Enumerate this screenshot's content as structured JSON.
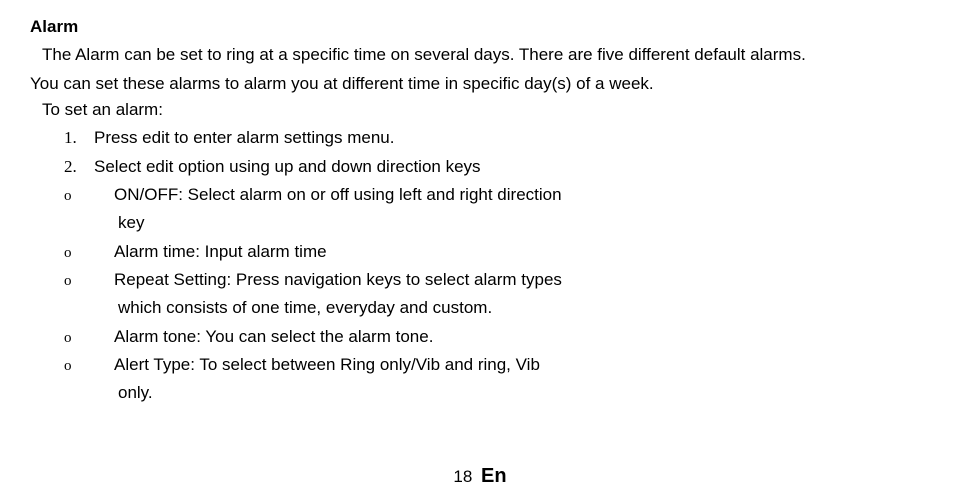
{
  "section": {
    "title": "Alarm",
    "intro_line1": "The Alarm can be set to ring at a specific time on several days. There are five different default alarms.",
    "intro_line2": "You can set these alarms to alarm you at different time in specific day(s) of a week.",
    "subtitle": "To set an alarm:",
    "steps": [
      {
        "num": "1.",
        "text": "Press edit to enter alarm settings menu."
      },
      {
        "num": "2.",
        "text": "Select edit option using up and down direction keys"
      }
    ],
    "options": [
      {
        "marker": "o",
        "text": "ON/OFF: Select alarm on or off using left and right direction",
        "cont": "key"
      },
      {
        "marker": "o",
        "text": "Alarm time: Input alarm time"
      },
      {
        "marker": "o",
        "text": "Repeat Setting: Press navigation keys to select alarm types",
        "cont": "which consists of one time, everyday  and custom."
      },
      {
        "marker": "o",
        "text": "Alarm tone: You can select the alarm tone."
      },
      {
        "marker": "o",
        "text": "Alert Type: To select between Ring only/Vib and ring, Vib",
        "cont": "only."
      }
    ]
  },
  "footer": {
    "page": "18",
    "lang": "En"
  }
}
